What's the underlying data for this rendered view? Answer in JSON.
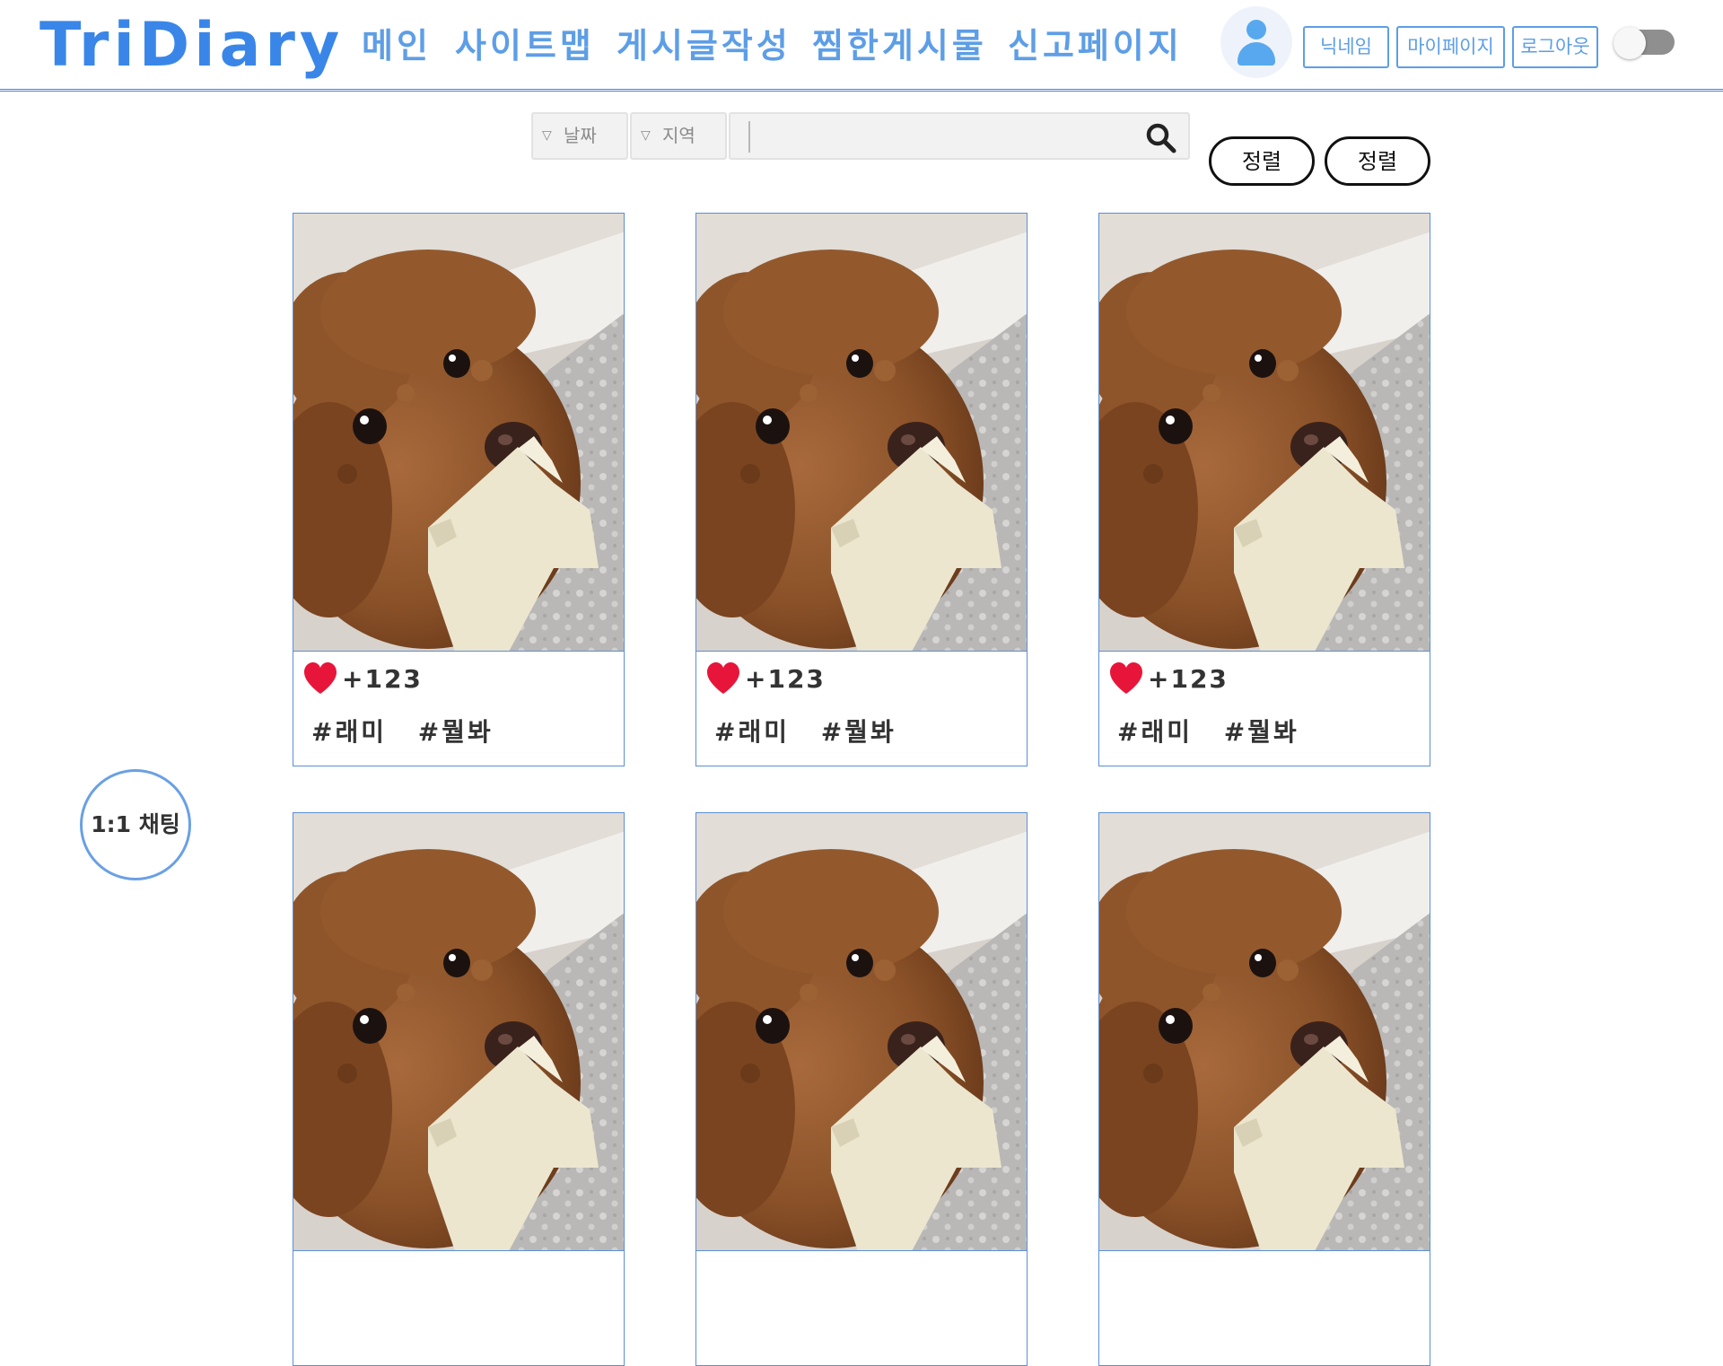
{
  "app": {
    "logo": "TriDiary"
  },
  "nav": {
    "items": [
      {
        "label": "메인"
      },
      {
        "label": "사이트맵"
      },
      {
        "label": "게시글작성"
      },
      {
        "label": "찜한게시물"
      },
      {
        "label": "신고페이지"
      }
    ]
  },
  "user": {
    "avatar_icon": "user-icon",
    "nickname_label": "닉네임",
    "mypage_label": "마이페이지",
    "logout_label": "로그아웃",
    "theme_toggle_on": false
  },
  "filters": {
    "date_label": "날짜",
    "region_label": "지역",
    "search_value": "",
    "search_icon": "search-icon",
    "sort_labels": [
      "정렬",
      "정렬"
    ]
  },
  "colors": {
    "accent": "#3a86e8",
    "nav": "#5d9ee6",
    "heart": "#e8153a"
  },
  "posts": [
    {
      "likes": "+123",
      "tags": [
        "#래미",
        "#뭘봐"
      ]
    },
    {
      "likes": "+123",
      "tags": [
        "#래미",
        "#뭘봐"
      ]
    },
    {
      "likes": "+123",
      "tags": [
        "#래미",
        "#뭘봐"
      ]
    },
    {
      "likes": "",
      "tags": []
    },
    {
      "likes": "",
      "tags": []
    },
    {
      "likes": "",
      "tags": []
    }
  ],
  "chat": {
    "label": "1:1 채팅"
  }
}
